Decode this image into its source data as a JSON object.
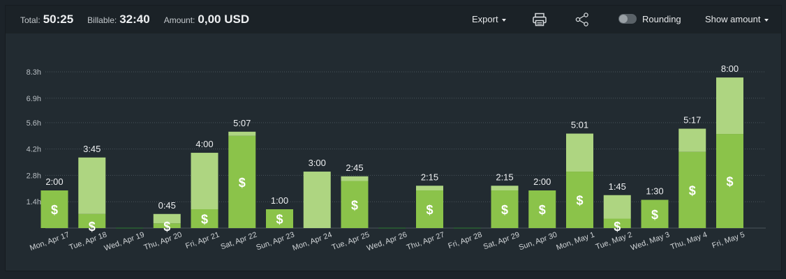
{
  "summary": {
    "total_label": "Total:",
    "total_value": "50:25",
    "billable_label": "Billable:",
    "billable_value": "32:40",
    "amount_label": "Amount:",
    "amount_value": "0,00 USD"
  },
  "toolbar": {
    "export_label": "Export",
    "rounding_label": "Rounding",
    "show_amount_label": "Show amount"
  },
  "colors": {
    "billable": "#8bc34a",
    "non_billable": "#aed581",
    "grid": "#4a545b",
    "axis_text": "#b8bec3",
    "label_text": "#eef0f2"
  },
  "chart_data": {
    "type": "bar",
    "stacked": true,
    "title": "",
    "xlabel": "",
    "ylabel": "",
    "ylim": [
      0,
      8.3
    ],
    "y_ticks": [
      1.4,
      2.8,
      4.2,
      5.6,
      6.9,
      8.3
    ],
    "y_tick_labels": [
      "1.4h",
      "2.8h",
      "4.2h",
      "5.6h",
      "6.9h",
      "8.3h"
    ],
    "grid": true,
    "categories": [
      "Mon, Apr 17",
      "Tue, Apr 18",
      "Wed, Apr 19",
      "Thu, Apr 20",
      "Fri, Apr 21",
      "Sat, Apr 22",
      "Sun, Apr 23",
      "Mon, Apr 24",
      "Tue, Apr 25",
      "Wed, Apr 26",
      "Thu, Apr 27",
      "Fri, Apr 28",
      "Sat, Apr 29",
      "Sun, Apr 30",
      "Mon, May 1",
      "Tue, May 2",
      "Wed, May 3",
      "Thu, May 4",
      "Fri, May 5"
    ],
    "totals": [
      2.0,
      3.75,
      0,
      0.75,
      4.0,
      5.12,
      1.0,
      3.0,
      2.75,
      0,
      2.25,
      0,
      2.25,
      2.0,
      5.02,
      1.75,
      1.5,
      5.28,
      8.0
    ],
    "total_labels": [
      "2:00",
      "3:45",
      "",
      "0:45",
      "4:00",
      "5:07",
      "1:00",
      "3:00",
      "2:45",
      "",
      "2:15",
      "",
      "2:15",
      "2:00",
      "5:01",
      "1:45",
      "1:30",
      "5:17",
      "8:00"
    ],
    "series": [
      {
        "values": [
          2.0,
          0.75,
          0,
          0.25,
          1.0,
          4.9,
          1.0,
          0,
          2.5,
          0,
          2.0,
          0,
          2.0,
          2.0,
          3.0,
          0.5,
          1.5,
          4.05,
          5.0
        ]
      },
      {
        "values": [
          0,
          3.0,
          0,
          0.5,
          3.0,
          0.22,
          0,
          3.0,
          0.25,
          0,
          0.25,
          0,
          0.25,
          0,
          2.02,
          1.25,
          0,
          1.23,
          3.0
        ]
      }
    ],
    "billable_marker": "$"
  }
}
